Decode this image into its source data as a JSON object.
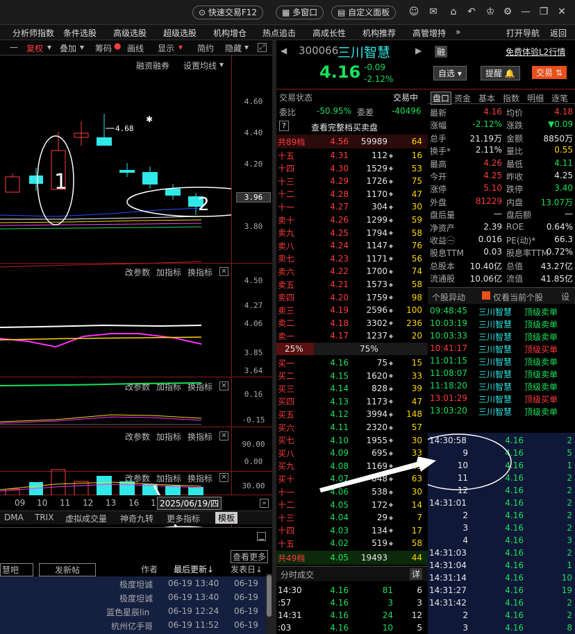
{
  "topbar": {
    "quick_trade": "快速交易F12",
    "multi_window": "多窗口",
    "custom_panel": "自定义面板"
  },
  "menu": [
    "分析师指数",
    "条件选股",
    "高级选股",
    "超级选股",
    "机构增仓",
    "热点追击",
    "高成长性",
    "机构推荐",
    "高管增持"
  ],
  "menu_more": "»",
  "menu_right": [
    "打开导航",
    "返回"
  ],
  "toolbar": {
    "fuquan": "复权",
    "diejia": "叠加",
    "chouma": "筹码",
    "huaxian": "画线",
    "xianshi": "显示",
    "jianyue": "简约",
    "yincang": "隐藏"
  },
  "chart": {
    "rzrq": "融资融券",
    "set_ma": "设置均线",
    "star": "✱",
    "high_label": "4.68",
    "ann1": "1",
    "ann2": "2",
    "price_ticks": [
      "4.60",
      "4.40",
      "4.20",
      "3.96",
      "3.80"
    ],
    "ind1_ticks": [
      "4.50",
      "4.27",
      "4.06",
      "3.85",
      "3.64"
    ],
    "ind2_ticks": [
      "0.16",
      "-0.15"
    ],
    "ind3_ticks": [
      "90.00",
      "0.00"
    ],
    "ind4_ticks": [
      "30.00"
    ],
    "gaicanshu": "改参数",
    "jiazhibiao": "加指标",
    "huanzhibiao": "换指标",
    "xdates": [
      "09",
      "10",
      "11",
      "12",
      "13",
      "16",
      "1"
    ],
    "date_box": "2025/06/19/四"
  },
  "bottom_tabs": [
    "DMA",
    "TRIX",
    "虚拟成交量",
    "神奇九转",
    "更多指标",
    "模板"
  ],
  "forum": {
    "tab": "慧吧",
    "post": "发新帖",
    "view_more": "查看更多",
    "col_author": "作者",
    "col_updated": "最后更新↓",
    "col_posted": "发表日↓",
    "rows": [
      {
        "author": "极度坦诚",
        "updated": "06-19 13:40",
        "posted": "06-19"
      },
      {
        "author": "极度坦诚",
        "updated": "06-19 13:40",
        "posted": "06-19"
      },
      {
        "author": "蓝色星辰lin",
        "updated": "06-19 12:24",
        "posted": "06-19"
      },
      {
        "author": "杭州亿手哥",
        "updated": "06-19 11:52",
        "posted": "06-19"
      }
    ]
  },
  "stock": {
    "code": "300066",
    "name": "三川智慧",
    "badge": "融",
    "l2": "免费体验L2行情",
    "price": "4.16",
    "change": "-0.09",
    "pct": "-2.12%",
    "zixuan": "自选",
    "tixing": "提醒",
    "jiaoyi": "交易"
  },
  "trade_state": {
    "label": "交易状态",
    "value": "交易中"
  },
  "weibi": {
    "label": "委比",
    "value": "-50.95%",
    "wc_label": "委差",
    "wc_value": "-40496"
  },
  "full_book": "查看完整档买卖盘",
  "ask_total": {
    "label": "共89档",
    "price": "4.56",
    "vol": "59989",
    "n": "64"
  },
  "asks": [
    {
      "l": "十五",
      "p": "4.31",
      "v": "112",
      "n": "16"
    },
    {
      "l": "十四",
      "p": "4.30",
      "v": "1529",
      "n": "53"
    },
    {
      "l": "十三",
      "p": "4.29",
      "v": "1726",
      "n": "75"
    },
    {
      "l": "十二",
      "p": "4.28",
      "v": "1170",
      "n": "47"
    },
    {
      "l": "十一",
      "p": "4.27",
      "v": "304",
      "n": "30"
    },
    {
      "l": "卖十",
      "p": "4.26",
      "v": "1299",
      "n": "59"
    },
    {
      "l": "卖九",
      "p": "4.25",
      "v": "1794",
      "n": "58"
    },
    {
      "l": "卖八",
      "p": "4.24",
      "v": "1147",
      "n": "76"
    },
    {
      "l": "卖七",
      "p": "4.23",
      "v": "1171",
      "n": "56"
    },
    {
      "l": "卖六",
      "p": "4.22",
      "v": "1700",
      "n": "74"
    },
    {
      "l": "卖五",
      "p": "4.21",
      "v": "1573",
      "n": "58"
    },
    {
      "l": "卖四",
      "p": "4.20",
      "v": "1759",
      "n": "98"
    },
    {
      "l": "卖三",
      "p": "4.19",
      "v": "2596",
      "n": "100"
    },
    {
      "l": "卖二",
      "p": "4.18",
      "v": "3302",
      "n": "236"
    },
    {
      "l": "卖一",
      "p": "4.17",
      "v": "1237",
      "n": "20"
    }
  ],
  "ratio": {
    "sell": "25%",
    "buy": "75%"
  },
  "bids": [
    {
      "l": "买一",
      "p": "4.16",
      "v": "75",
      "n": "15"
    },
    {
      "l": "买二",
      "p": "4.15",
      "v": "1620",
      "n": "33"
    },
    {
      "l": "买三",
      "p": "4.14",
      "v": "828",
      "n": "39"
    },
    {
      "l": "买四",
      "p": "4.13",
      "v": "1173",
      "n": "47"
    },
    {
      "l": "买五",
      "p": "4.12",
      "v": "3994",
      "n": "148"
    },
    {
      "l": "买六",
      "p": "4.11",
      "v": "2320",
      "n": "57"
    },
    {
      "l": "买七",
      "p": "4.10",
      "v": "1955",
      "n": "30"
    },
    {
      "l": "买八",
      "p": "4.09",
      "v": "695",
      "n": "33"
    },
    {
      "l": "买九",
      "p": "4.08",
      "v": "1169",
      "n": "45"
    },
    {
      "l": "买十",
      "p": "4.07",
      "v": "848",
      "n": "63"
    },
    {
      "l": "十一",
      "p": "4.06",
      "v": "538",
      "n": "30"
    },
    {
      "l": "十二",
      "p": "4.05",
      "v": "172",
      "n": "14"
    },
    {
      "l": "十三",
      "p": "4.04",
      "v": "29",
      "n": "7"
    },
    {
      "l": "十四",
      "p": "4.03",
      "v": "134",
      "n": "17"
    },
    {
      "l": "十五",
      "p": "4.02",
      "v": "519",
      "n": "58"
    }
  ],
  "bid_total": {
    "label": "共49档",
    "price": "4.05",
    "vol": "19493",
    "n": "44"
  },
  "ticks_panel": {
    "title": "分时成交",
    "detail": "详",
    "rows": [
      {
        "t": "14:30",
        "p": "4.16",
        "v": "81",
        "n": "6"
      },
      {
        "t": ":57",
        "p": "4.16",
        "v": "3",
        "n": "3"
      },
      {
        "t": "14:31",
        "p": "4.16",
        "v": "24",
        "n": "12"
      },
      {
        "t": ":03",
        "p": "4.16",
        "v": "10",
        "n": "5"
      }
    ]
  },
  "tabs": [
    "盘口",
    "资金",
    "基本",
    "指数",
    "明细",
    "逐笔"
  ],
  "quote": [
    {
      "a": "最新",
      "av": "4.16",
      "b": "均价",
      "bv": "4.18"
    },
    {
      "a": "涨幅",
      "av": "-2.12%",
      "b": "涨跌",
      "bv": "▼0.09"
    },
    {
      "a": "总手",
      "av": "21.19万",
      "b": "金额",
      "bv": "8850万"
    },
    {
      "a": "换手*",
      "av": "2.11%",
      "b": "量比",
      "bv": "0.55"
    },
    {
      "a": "最高",
      "av": "4.26",
      "b": "最低",
      "bv": "4.11"
    },
    {
      "a": "今开",
      "av": "4.25",
      "b": "昨收",
      "av2": "",
      "bv": "4.25"
    },
    {
      "a": "涨停",
      "av": "5.10",
      "b": "跌停",
      "bv": "3.40"
    },
    {
      "a": "外盘",
      "av": "81229",
      "b": "内盘",
      "bv": "13.07万"
    },
    {
      "a": "盘后量",
      "av": "—",
      "b": "盘后额",
      "bv": "—"
    },
    {
      "a": "净资产",
      "av": "2.39",
      "b": "ROE",
      "bv": "0.64%"
    },
    {
      "a": "收益㊀",
      "av": "0.016",
      "b": "PE(动)*",
      "bv": "66.3"
    },
    {
      "a": "股息TTM",
      "av": "0.03",
      "b": "股息率TTM",
      "bv": "0.72%"
    },
    {
      "a": "总股本",
      "av": "10.40亿",
      "b": "总值",
      "bv": "43.27亿"
    },
    {
      "a": "流通股",
      "av": "10.06亿",
      "b": "流值",
      "bv": "41.85亿"
    }
  ],
  "anomaly": {
    "title": "个股异动",
    "only_current": "仅看当前个股",
    "settings": "设",
    "rows": [
      {
        "t": "09:48:45",
        "name": "三川智慧",
        "type": "顶级卖单",
        "c": "grn"
      },
      {
        "t": "10:03:19",
        "name": "三川智慧",
        "type": "顶级卖单",
        "c": "grn"
      },
      {
        "t": "10:03:33",
        "name": "三川智慧",
        "type": "顶级卖单",
        "c": "grn"
      },
      {
        "t": "10:41:17",
        "name": "三川智慧",
        "type": "顶级买单",
        "c": "red"
      },
      {
        "t": "11:01:15",
        "name": "三川智慧",
        "type": "顶级卖单",
        "c": "grn"
      },
      {
        "t": "11:08:07",
        "name": "三川智慧",
        "type": "顶级卖单",
        "c": "grn"
      },
      {
        "t": "11:18:20",
        "name": "三川智慧",
        "type": "顶级卖单",
        "c": "grn"
      },
      {
        "t": "13:01:29",
        "name": "三川智慧",
        "type": "顶级买单",
        "c": "red"
      },
      {
        "t": "13:03:20",
        "name": "三川智慧",
        "type": "顶级卖单",
        "c": "grn"
      }
    ]
  },
  "detail_ticks": [
    {
      "t": "14:30:58",
      "p": "4.16",
      "v": "2"
    },
    {
      "t": "9",
      "p": "4.16",
      "v": "5"
    },
    {
      "t": "10",
      "p": "4.16",
      "v": "1"
    },
    {
      "t": "11",
      "p": "4.16",
      "v": "2"
    },
    {
      "t": "12",
      "p": "4.16",
      "v": "2"
    },
    {
      "t": "14:31:01",
      "p": "4.16",
      "v": "2"
    },
    {
      "t": "2",
      "p": "4.16",
      "v": "2"
    },
    {
      "t": "3",
      "p": "4.16",
      "v": "2"
    },
    {
      "t": "4",
      "p": "4.16",
      "v": "3"
    },
    {
      "t": "14:31:03",
      "p": "4.16",
      "v": "2"
    },
    {
      "t": "14:31:04",
      "p": "4.16",
      "v": "1"
    },
    {
      "t": "14:31:14",
      "p": "4.16",
      "v": "10"
    },
    {
      "t": "14:31:27",
      "p": "4.16",
      "v": "19"
    },
    {
      "t": "14:31:42",
      "p": "4.16",
      "v": "2"
    },
    {
      "t": "2",
      "p": "4.16",
      "v": "2"
    },
    {
      "t": "3",
      "p": "4.16",
      "v": "8"
    }
  ]
}
